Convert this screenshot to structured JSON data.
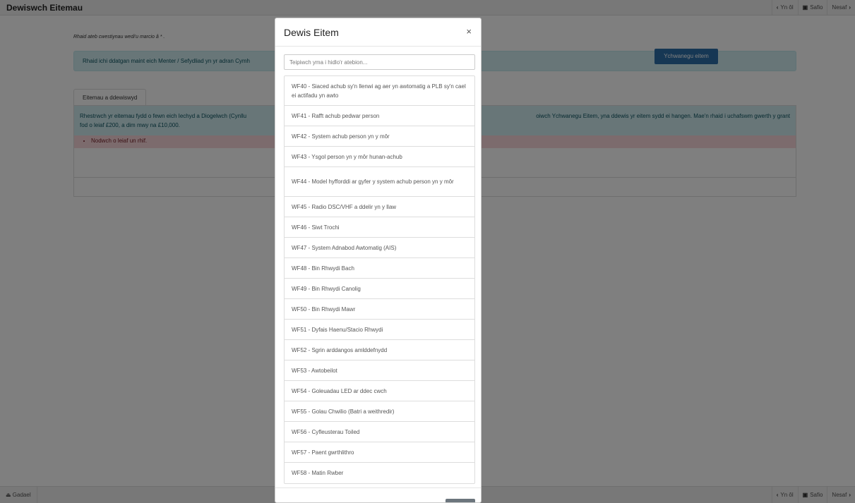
{
  "header": {
    "title": "Dewiswch Eitemau",
    "back_label": "Yn ôl",
    "save_label": "Safio",
    "next_label": "Nesaf"
  },
  "footer": {
    "leave_label": "Gadael",
    "back_label": "Yn ôl",
    "save_label": "Safio",
    "next_label": "Nesaf"
  },
  "main": {
    "required_note": "Rhaid ateb cwestiynau wedi'u marcio â * .",
    "info_alert": "Rhaid ichi ddatgan maint eich Menter / Sefydliad yn yr adran Cymh",
    "tab_label": "Eitemau a ddewiswyd",
    "panel_info": "Rhestrwch yr eitemau fydd o fewn eich Iechyd a Diogelwch (Cynllu                                                                                                                                                                                   oiwch Ychwanegu Eitem, yna ddewis yr eitem sydd ei hangen. Mae'n rhaid i uchafswm gwerth y grant fod o leiaf £200, a dim mwy na £10,000.",
    "panel_info_line1_left": "Rhestrwch yr eitemau fydd o fewn eich Iechyd a Diogelwch (Cynllu",
    "panel_info_line1_right": "oiwch Ychwanegu Eitem, yna ddewis yr eitem sydd ei hangen. Mae'n rhaid i uchafswm gwerth y grant",
    "panel_info_line2": "fod o leiaf £200, a dim mwy na £10,000.",
    "error": "Nodwch o leiaf un rhif.",
    "add_button": "Ychwanegu eitem"
  },
  "modal": {
    "title": "Dewis Eitem",
    "close": "×",
    "filter_placeholder": "Teipiwch yma i hidlo'r atebion...",
    "items": [
      "WF40 - Siaced achub sy'n llenwi ag aer yn awtomatig a PLB sy'n cael ei actifadu yn awto",
      "WF41 - Rafft achub pedwar person",
      "WF42 - System achub person yn y môr",
      "WF43 - Ysgol person yn y môr hunan-achub",
      "WF44 - Model hyfforddi ar gyfer y system achub person yn y môr",
      "WF45 - Radio DSC/VHF a ddelir yn y llaw",
      "WF46 - Siwt Trochi",
      "WF47 - System Adnabod Awtomatig (AIS)",
      "WF48 - Bin Rhwydi Bach",
      "WF49 - Bin Rhwydi Canolig",
      "WF50 - Bin Rhwydi Mawr",
      "WF51 - Dyfais Haenu/Stacio Rhwydi",
      "WF52 - Sgrin arddangos amlddefnydd",
      "WF53 - Awtobeilot",
      "WF54 - Goleuadau LED ar ddec cwch",
      "WF55 - Golau Chwilio (Batri a weithredir)",
      "WF56 - Cyfleusterau Toiled",
      "WF57 - Paent gwrthlithro",
      "WF58 - Matin Rwber"
    ]
  },
  "colors": {
    "info_bg": "#d1ecf1",
    "danger_bg": "#f8d7da",
    "primary": "#2c6ea8"
  }
}
